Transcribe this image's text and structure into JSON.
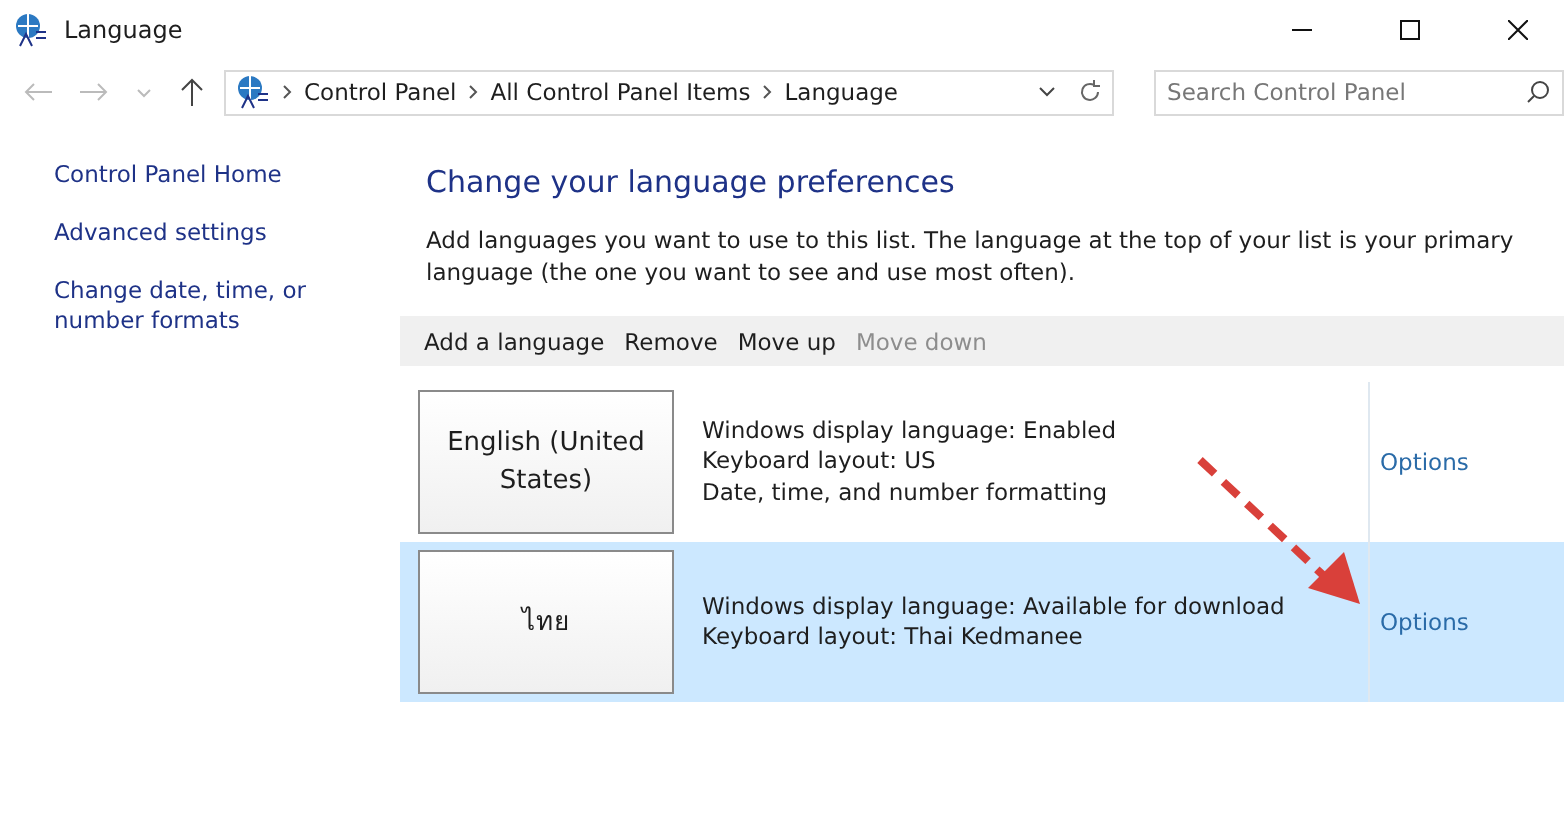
{
  "window": {
    "title": "Language"
  },
  "address_bar": {
    "crumbs": [
      "Control Panel",
      "All Control Panel Items",
      "Language"
    ]
  },
  "search": {
    "placeholder": "Search Control Panel"
  },
  "sidebar": {
    "items": [
      {
        "label": "Control Panel Home"
      },
      {
        "label": "Advanced settings"
      },
      {
        "label": "Change date, time, or number formats"
      }
    ]
  },
  "heading": "Change your language preferences",
  "description": "Add languages you want to use to this list. The language at the top of your list is your primary language (the one you want to see and use most often).",
  "toolbar": [
    {
      "label": "Add a language",
      "disabled": false
    },
    {
      "label": "Remove",
      "disabled": false
    },
    {
      "label": "Move up",
      "disabled": false
    },
    {
      "label": "Move down",
      "disabled": true
    }
  ],
  "languages": [
    {
      "name": "English (United States)",
      "details": [
        "Windows display language: Enabled",
        "Keyboard layout: US",
        "Date, time, and number formatting"
      ],
      "options": "Options",
      "selected": false
    },
    {
      "name": "ไทย",
      "details": [
        "Windows display language: Available for download",
        "Keyboard layout: Thai Kedmanee"
      ],
      "options": "Options",
      "selected": true
    }
  ]
}
